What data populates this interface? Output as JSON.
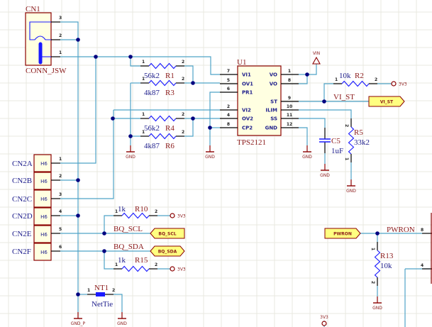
{
  "colors": {
    "wire": "#4fa3c7",
    "junction": "#000080",
    "outline": "#8b0000",
    "body": "#ffffe1",
    "resistor": "#1a1aff",
    "port_fill": "#ffff80"
  },
  "cn1": {
    "designator": "CN1",
    "comment": "CONN_JSW",
    "pins": [
      "3",
      "2",
      "1"
    ]
  },
  "u1": {
    "designator": "U1",
    "comment": "TPS2121",
    "left_pins": [
      {
        "num": "7",
        "name": "VI1"
      },
      {
        "num": "5",
        "name": "OV1"
      },
      {
        "num": "6",
        "name": "PR1"
      },
      {
        "num": "2",
        "name": "VI2"
      },
      {
        "num": "4",
        "name": "OV2"
      },
      {
        "num": "8",
        "name": "CP2"
      }
    ],
    "right_pins": [
      {
        "num": "1",
        "name": "VO"
      },
      {
        "num": "8",
        "name": "VO"
      },
      {
        "num": "9",
        "name": "ST"
      },
      {
        "num": "10",
        "name": "ILIM"
      },
      {
        "num": "11",
        "name": "SS"
      },
      {
        "num": "12",
        "name": "GND"
      }
    ]
  },
  "resistors": {
    "r1": {
      "designator": "R1",
      "value": "56k2"
    },
    "r3": {
      "designator": "R3",
      "value": "4k87"
    },
    "r4": {
      "designator": "R4",
      "value": "56k2"
    },
    "r6": {
      "designator": "R6",
      "value": "4k87"
    },
    "r2": {
      "designator": "R2",
      "value": "10k"
    },
    "r5": {
      "designator": "R5",
      "value": "33k2"
    },
    "r10": {
      "designator": "R10",
      "value": "1k"
    },
    "r15": {
      "designator": "R15",
      "value": "1k"
    },
    "r13": {
      "designator": "R13",
      "value": "10k"
    }
  },
  "pin_labels": {
    "p1": "1",
    "p2": "2"
  },
  "c5": {
    "designator": "C5",
    "value": "1uF"
  },
  "cn2": {
    "parts": [
      {
        "designator": "CN2A",
        "comment": "H6",
        "pin": "1"
      },
      {
        "designator": "CN2B",
        "comment": "H6",
        "pin": "2"
      },
      {
        "designator": "CN2C",
        "comment": "H6",
        "pin": "3"
      },
      {
        "designator": "CN2D",
        "comment": "H6",
        "pin": "4"
      },
      {
        "designator": "CN2E",
        "comment": "H6",
        "pin": "5"
      },
      {
        "designator": "CN2F",
        "comment": "H6",
        "pin": "6"
      }
    ]
  },
  "nt1": {
    "designator": "NT1",
    "comment": "NetTie"
  },
  "power": {
    "gnd": "GND",
    "gnd_p": "GND_P",
    "vin": "VIN",
    "v3v3": "3V3"
  },
  "net_labels": {
    "vi_st": "VI_ST",
    "bq_scl": "BQ_SCL",
    "bq_sda": "BQ_SDA",
    "pwron": "PWRON"
  },
  "ports": {
    "vi_st": "VI_ST",
    "bq_scl": "BQ_SCL",
    "bq_sda": "BQ_SDA",
    "pwron": "PWRON"
  },
  "partial": {
    "pin8": "8",
    "pin4": "4"
  }
}
